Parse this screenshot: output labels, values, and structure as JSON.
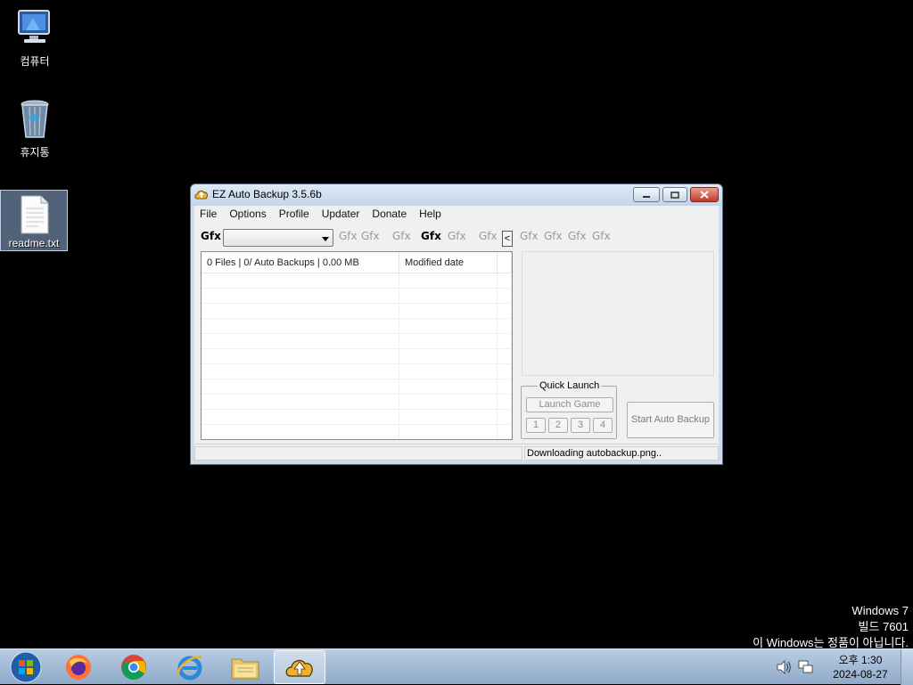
{
  "desktop": {
    "icons": [
      {
        "label": "컴퓨터",
        "name": "computer"
      },
      {
        "label": "휴지통",
        "name": "recycle-bin"
      },
      {
        "label": "readme.txt",
        "name": "readme-file"
      }
    ],
    "watermark": {
      "line1": "Windows 7",
      "line2": "빌드 7601",
      "line3": "이 Windows는 정품이 아닙니다."
    }
  },
  "window": {
    "title": "EZ Auto Backup 3.5.6b",
    "menu": [
      "File",
      "Options",
      "Profile",
      "Updater",
      "Donate",
      "Help"
    ],
    "toolbar": {
      "gfx_label": "Gfx",
      "selected_profile": "",
      "gfx_buttons": [
        "Gfx",
        "Gfx",
        "Gfx",
        "Gfx",
        "Gfx",
        "Gfx",
        "Gfx",
        "Gfx",
        "Gfx",
        "Gfx"
      ],
      "collapse_label": "<"
    },
    "list": {
      "columns": [
        "0 Files | 0/ Auto Backups | 0.00 MB",
        "Modified date"
      ],
      "rows": []
    },
    "quick_launch": {
      "title": "Quick Launch",
      "launch_label": "Launch Game",
      "slots": [
        "1",
        "2",
        "3",
        "4"
      ]
    },
    "start_button_label": "Start Auto Backup",
    "status": {
      "left": "",
      "right": "Downloading autobackup.png.."
    }
  },
  "taskbar": {
    "items": [
      "start",
      "firefox",
      "chrome",
      "internet-explorer",
      "file-explorer",
      "ez-auto-backup"
    ],
    "clock": {
      "time": "오후 1:30",
      "date": "2024-08-27"
    }
  },
  "colors": {
    "accent": "#c0392b",
    "desktop": "#000000",
    "taskbar": "#a9bfdb"
  }
}
